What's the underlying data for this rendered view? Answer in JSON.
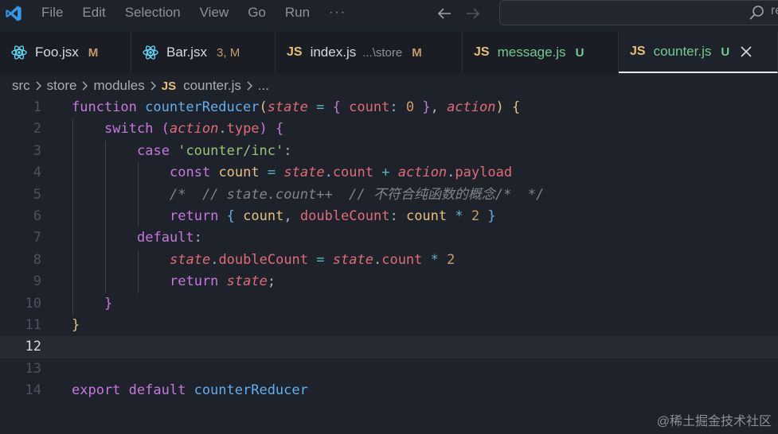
{
  "menu": {
    "items": [
      "File",
      "Edit",
      "Selection",
      "View",
      "Go",
      "Run",
      "···"
    ]
  },
  "search": {
    "text": "re"
  },
  "tabs": [
    {
      "label": "Foo.jsx",
      "desc": "",
      "badge": "M",
      "icon": "react-icon",
      "active": false
    },
    {
      "label": "Bar.jsx",
      "desc": "",
      "badge": "3, M",
      "icon": "react-icon",
      "active": false
    },
    {
      "label": "index.js",
      "desc": "...\\store",
      "badge": "M",
      "icon": "js-icon",
      "active": false
    },
    {
      "label": "message.js",
      "desc": "",
      "badge": "U",
      "icon": "js-icon",
      "active": false
    },
    {
      "label": "counter.js",
      "desc": "",
      "badge": "U",
      "icon": "js-icon",
      "active": true
    }
  ],
  "js_glyph": "JS",
  "breadcrumb": {
    "items": [
      "src",
      "store",
      "modules"
    ],
    "file": "counter.js",
    "more": "..."
  },
  "editor": {
    "current_line": 12,
    "line_numbers": [
      "1",
      "2",
      "3",
      "4",
      "5",
      "6",
      "7",
      "8",
      "9",
      "10",
      "11",
      "12",
      "13",
      "14"
    ],
    "lines": [
      "function counterReducer(state = { count: 0 }, action) {",
      "switch (action.type) {",
      "case 'counter/inc':",
      "const count = state.count + action.payload",
      "/*  // state.count++  // 不符合纯函数的概念/*  */",
      "return { count, doubleCount: count * 2 }",
      "default:",
      "state.doubleCount = state.count * 2",
      "return state;",
      "}",
      "}",
      "",
      "",
      "export default counterReducer"
    ]
  },
  "watermark": "@稀土掘金技术社区",
  "colors": {
    "background": "#1e222a",
    "keyword": "#c678dd",
    "function": "#61afef",
    "parameter": "#e06c75",
    "number": "#d19a66",
    "string": "#98c379",
    "comment": "#7f848e",
    "modified_badge": "#c59a6a",
    "untracked_badge": "#73c991"
  }
}
